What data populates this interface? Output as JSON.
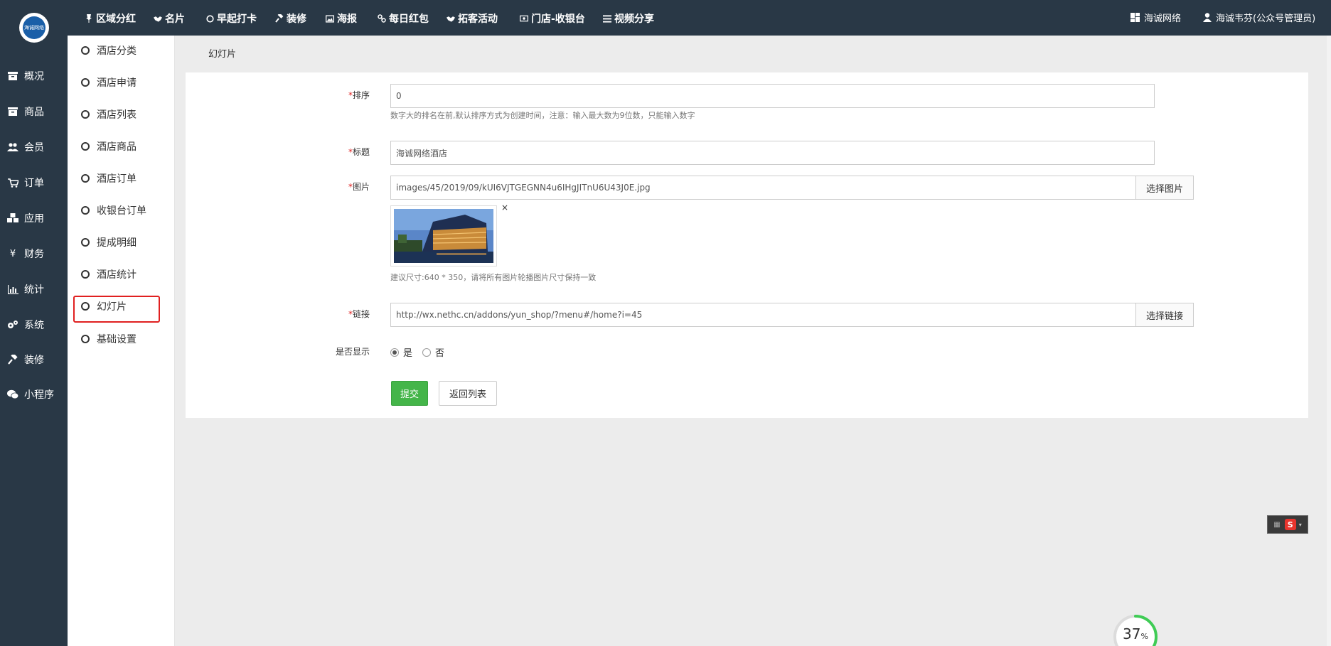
{
  "logo": {
    "text": "海诚网络"
  },
  "leftnav": [
    {
      "label": "概况",
      "icon": "archive-icon"
    },
    {
      "label": "商品",
      "icon": "archive-icon"
    },
    {
      "label": "会员",
      "icon": "users-icon"
    },
    {
      "label": "订单",
      "icon": "cart-icon"
    },
    {
      "label": "应用",
      "icon": "cubes-icon"
    },
    {
      "label": "财务",
      "icon": "yen-icon"
    },
    {
      "label": "统计",
      "icon": "bar-chart-icon"
    },
    {
      "label": "系统",
      "icon": "gears-icon"
    },
    {
      "label": "装修",
      "icon": "gavel-icon"
    },
    {
      "label": "小程序",
      "icon": "wechat-icon"
    }
  ],
  "topmenu": [
    {
      "label": "区域分红",
      "icon": "pin-icon"
    },
    {
      "label": "名片",
      "icon": "handshake-icon"
    },
    {
      "label": "早起打卡",
      "icon": "circle-icon"
    },
    {
      "label": "装修",
      "icon": "gavel-icon"
    },
    {
      "label": "海报",
      "icon": "image-icon"
    },
    {
      "label": "每日红包",
      "icon": "link-icon"
    },
    {
      "label": "拓客活动",
      "icon": "handshake-icon"
    },
    {
      "label": "门店-收银台",
      "icon": "money-icon"
    },
    {
      "label": "视频分享",
      "icon": "list-icon"
    }
  ],
  "topright": {
    "company": "海诚网络",
    "user": "海诚韦芬(公众号管理员)"
  },
  "submenu": [
    {
      "label": "酒店分类"
    },
    {
      "label": "酒店申请"
    },
    {
      "label": "酒店列表"
    },
    {
      "label": "酒店商品"
    },
    {
      "label": "酒店订单"
    },
    {
      "label": "收银台订单"
    },
    {
      "label": "提成明细"
    },
    {
      "label": "酒店统计"
    },
    {
      "label": "幻灯片"
    },
    {
      "label": "基础设置"
    }
  ],
  "page_title": "幻灯片",
  "form": {
    "sort": {
      "label": "排序",
      "value": "0",
      "help": "数字大的排名在前,默认排序方式为创建时间，注意：输入最大数为9位数，只能输入数字"
    },
    "title": {
      "label": "标题",
      "value": "海诚网络酒店"
    },
    "image": {
      "label": "图片",
      "value": "images/45/2019/09/kUI6VJTGEGNN4u6IHgJITnU6U43J0E.jpg",
      "button": "选择图片",
      "help": "建议尺寸:640 * 350，请将所有图片轮播图片尺寸保持一致"
    },
    "link": {
      "label": "链接",
      "value": "http://wx.nethc.cn/addons/yun_shop/?menu#/home?i=45",
      "button": "选择链接"
    },
    "show": {
      "label": "是否显示",
      "yes": "是",
      "no": "否",
      "selected": "yes"
    },
    "required_mark": "*",
    "submit": "提交",
    "back": "返回列表"
  },
  "ime": {
    "label": "S"
  },
  "progress": {
    "value": "37",
    "unit": "%",
    "fraction": 0.37
  },
  "colors": {
    "sidebar": "#293846",
    "accent_green": "#44b549",
    "highlight_red": "#e02020"
  }
}
